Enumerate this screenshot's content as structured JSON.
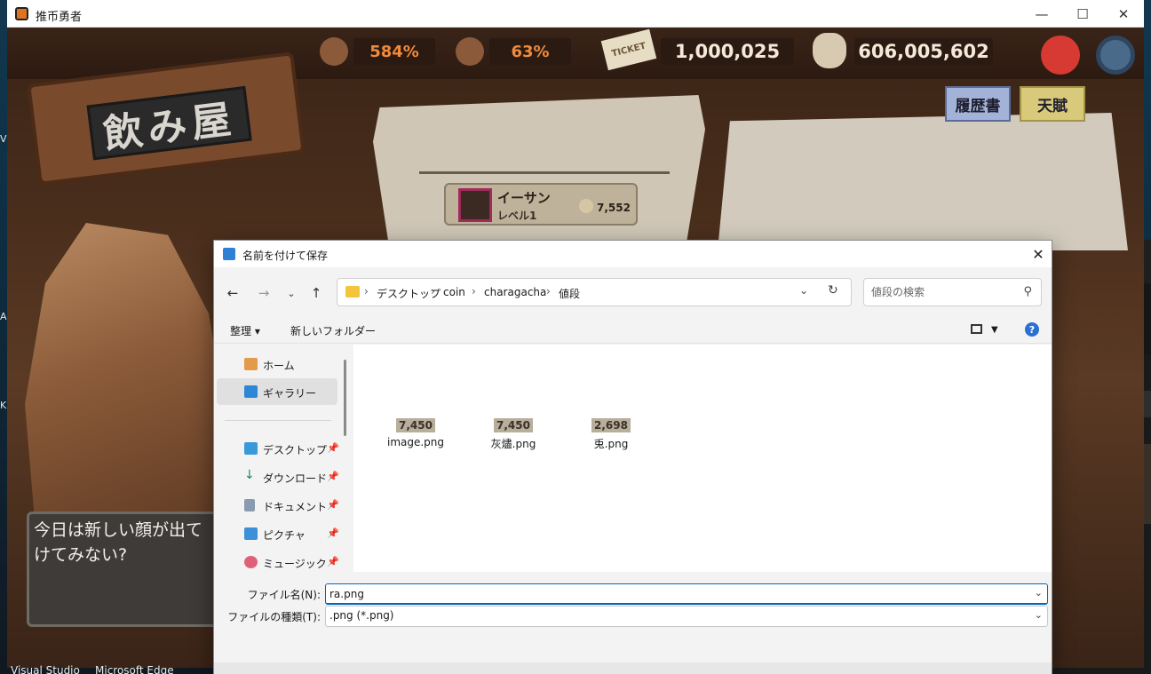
{
  "game": {
    "window_title": "推币勇者",
    "stats": {
      "stat1": "584%",
      "stat2": "63%",
      "tickets": "1,000,025",
      "coins": "606,005,602",
      "ticket_icon_text": "TICKET"
    },
    "sign_title": "飲み屋",
    "character": {
      "name": "イーサン",
      "level": "レベル1",
      "coins": "7,552"
    },
    "tabs": {
      "history": "履歴書",
      "talent": "天賦"
    },
    "speech_line1": "今日は新しい顔が出て",
    "speech_line2": "けてみない?"
  },
  "dialog": {
    "title": "名前を付けて保存",
    "breadcrumb": [
      "デスクトップ",
      "coin",
      "charagacha",
      "値段"
    ],
    "search_placeholder": "値段の検索",
    "commands": {
      "organize": "整理",
      "new_folder": "新しいフォルダー"
    },
    "sidebar": {
      "top_items": [
        "ホーム",
        "ギャラリー"
      ],
      "pinned_items": [
        "デスクトップ",
        "ダウンロード",
        "ドキュメント",
        "ピクチャ",
        "ミュージック"
      ]
    },
    "files": [
      {
        "thumb": "7,450",
        "name": "image.png"
      },
      {
        "thumb": "7,450",
        "name": "灰燼.png"
      },
      {
        "thumb": "2,698",
        "name": "兎.png"
      }
    ],
    "filename_label": "ファイル名(N):",
    "filename_value": "ra.png",
    "filetype_label": "ファイルの種類(T):",
    "filetype_value": ".png (*.png)"
  },
  "taskbar": {
    "items": [
      "Visual Studio",
      "Microsoft Edge"
    ]
  },
  "colors": {
    "accent": "#0067c0",
    "orange_stat": "#f08a3c",
    "folder": "#f3c43c",
    "help": "#2a6fd1"
  }
}
